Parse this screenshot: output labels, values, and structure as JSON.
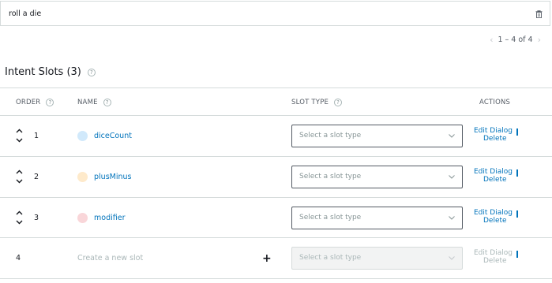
{
  "utterance": {
    "text": "roll a die",
    "delete_icon": "trash-icon"
  },
  "pagination": {
    "label": "1 – 4 of 4"
  },
  "intent_slots": {
    "title": "Intent Slots (3)",
    "help_icon": "help-circle-icon"
  },
  "table": {
    "headers": {
      "order": "ORDER",
      "name": "NAME",
      "slot_type": "SLOT TYPE",
      "actions": "ACTIONS"
    },
    "rows": [
      {
        "order": "1",
        "name": "diceCount",
        "dot_color": "#d1e9fb",
        "slot_type_placeholder": "Select a slot type",
        "edit_label": "Edit Dialog",
        "delete_label": "Delete"
      },
      {
        "order": "2",
        "name": "plusMinus",
        "dot_color": "#feeacb",
        "slot_type_placeholder": "Select a slot type",
        "edit_label": "Edit Dialog",
        "delete_label": "Delete"
      },
      {
        "order": "3",
        "name": "modifier",
        "dot_color": "#f9d6d9",
        "slot_type_placeholder": "Select a slot type",
        "edit_label": "Edit Dialog",
        "delete_label": "Delete"
      }
    ],
    "new_row": {
      "order": "4",
      "placeholder": "Create a new slot",
      "slot_type_placeholder": "Select a slot type",
      "edit_label": "Edit Dialog",
      "delete_label": "Delete"
    }
  }
}
